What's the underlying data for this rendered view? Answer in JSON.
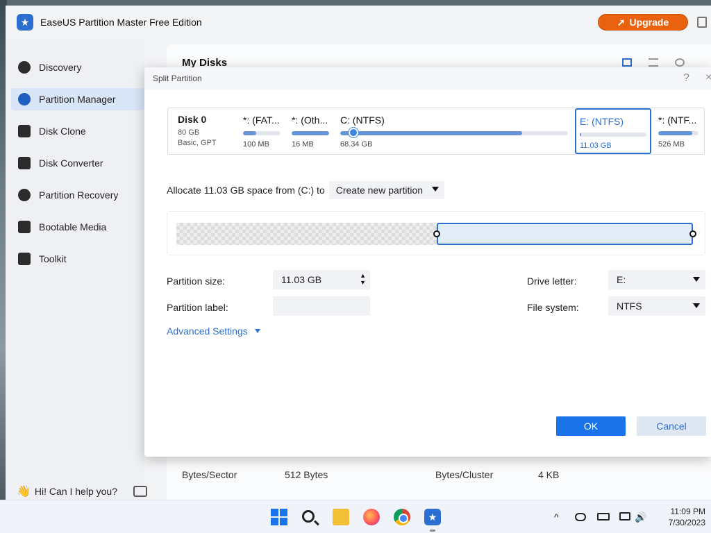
{
  "app": {
    "title": "EaseUS Partition Master Free Edition",
    "upgrade_label": "Upgrade",
    "logo_glyph": "★"
  },
  "sidebar": {
    "items": [
      {
        "label": "Discovery",
        "icon": "compass-icon",
        "active": false
      },
      {
        "label": "Partition Manager",
        "icon": "pie-chart-icon",
        "active": true
      },
      {
        "label": "Disk Clone",
        "icon": "clone-icon",
        "active": false
      },
      {
        "label": "Disk Converter",
        "icon": "convert-icon",
        "active": false
      },
      {
        "label": "Partition Recovery",
        "icon": "recovery-icon",
        "active": false
      },
      {
        "label": "Bootable Media",
        "icon": "media-icon",
        "active": false
      },
      {
        "label": "Toolkit",
        "icon": "toolbox-icon",
        "active": false
      }
    ],
    "help_text": "Hi! Can I help you?",
    "help_emoji": "👋"
  },
  "main": {
    "title": "My Disks",
    "bottom_info": {
      "bps_label": "Bytes/Sector",
      "bps_value": "512 Bytes",
      "bpc_label": "Bytes/Cluster",
      "bpc_value": "4 KB"
    }
  },
  "dialog": {
    "title": "Split Partition",
    "help_glyph": "?",
    "close_glyph": "×",
    "disk": {
      "name": "Disk 0",
      "size": "80 GB",
      "type": "Basic, GPT"
    },
    "partitions": [
      {
        "name": "*: (FAT...",
        "size": "100 MB",
        "fill": 0.35,
        "selected": false
      },
      {
        "name": "*: (Oth...",
        "size": "16 MB",
        "fill": 1.0,
        "selected": false
      },
      {
        "name": "C: (NTFS)",
        "size": "68.34 GB",
        "fill": 0.8,
        "selected": false
      },
      {
        "name": "E: (NTFS)",
        "size": "11.03 GB",
        "fill": 0.02,
        "selected": true
      },
      {
        "name": "*: (NTF...",
        "size": "526 MB",
        "fill": 0.85,
        "selected": false
      }
    ],
    "allocate_text": "Allocate 11.03 GB space from (C:) to",
    "allocate_target": "Create new partition",
    "split_fraction": 0.49,
    "form": {
      "partition_size_label": "Partition size:",
      "partition_size_value": "11.03 GB",
      "partition_label_label": "Partition label:",
      "partition_label_value": "",
      "drive_letter_label": "Drive letter:",
      "drive_letter_value": "E:",
      "file_system_label": "File system:",
      "file_system_value": "NTFS"
    },
    "advanced_label": "Advanced Settings",
    "ok_label": "OK",
    "cancel_label": "Cancel"
  },
  "taskbar": {
    "time": "11:09 PM",
    "date": "7/30/2023",
    "easeus_glyph": "★",
    "tray": {
      "chevron": "^",
      "volume": "🔊"
    }
  },
  "colors": {
    "accent": "#2d6fd1",
    "upgrade": "#e8620f",
    "ok_button": "#1a73e8"
  }
}
